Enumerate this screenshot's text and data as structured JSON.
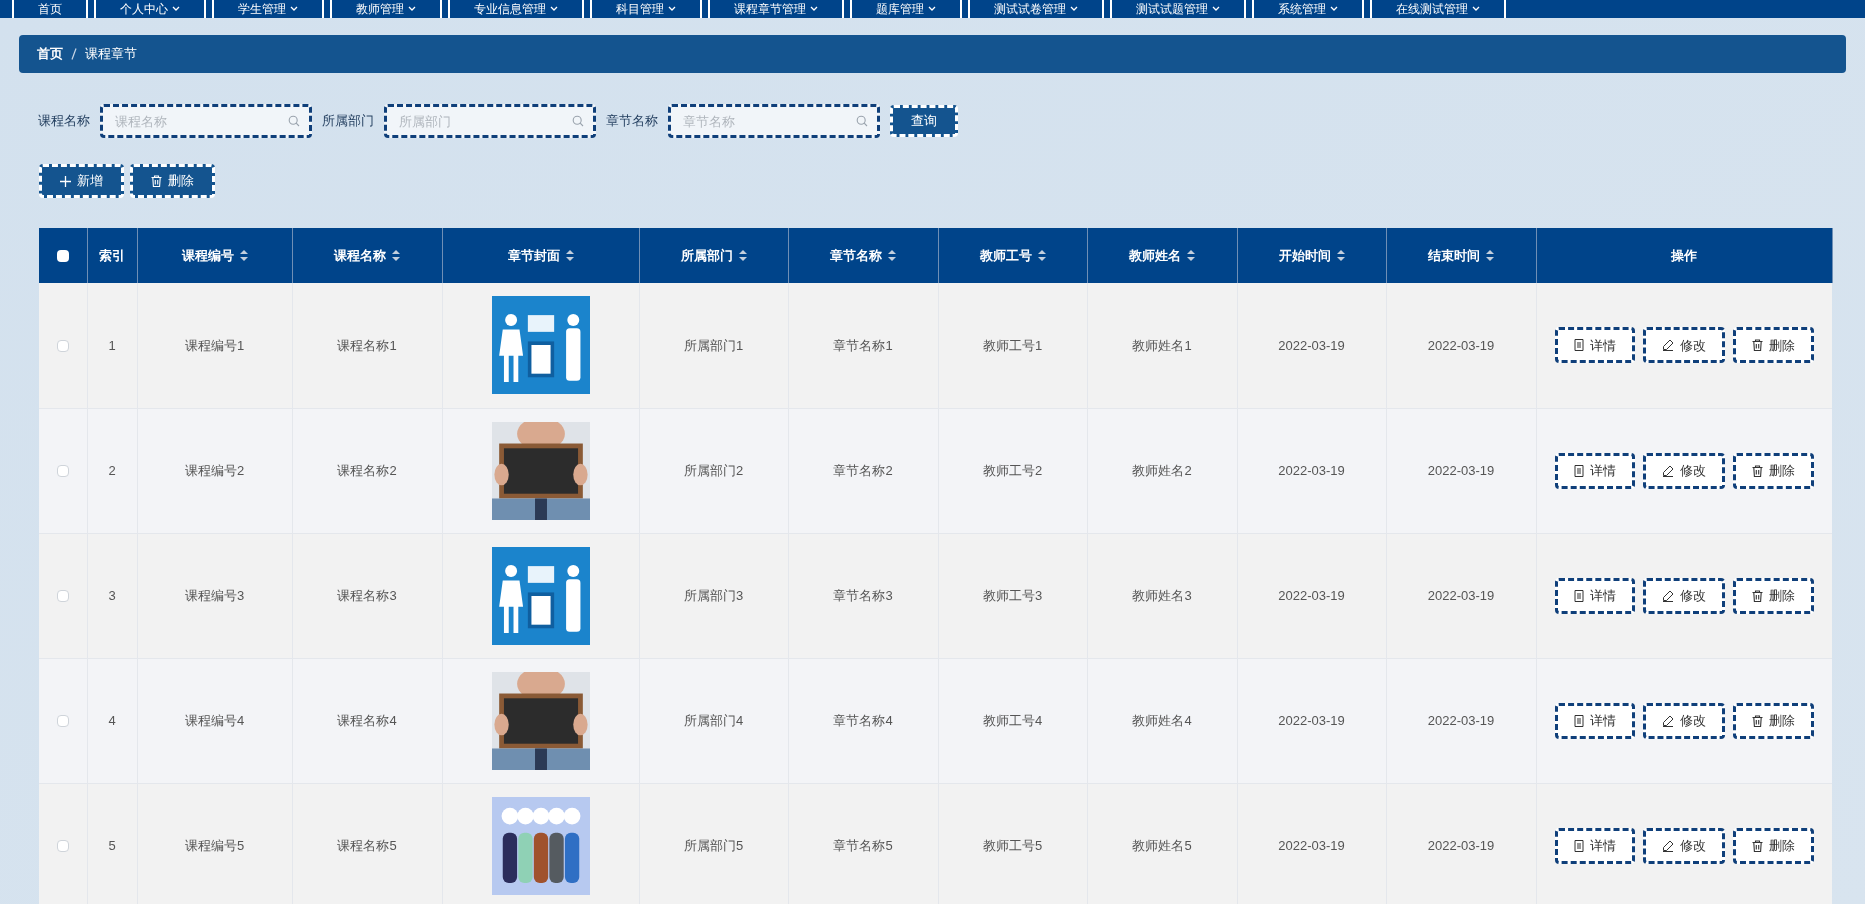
{
  "nav": [
    {
      "label": "首页",
      "dropdown": false
    },
    {
      "label": "个人中心",
      "dropdown": true
    },
    {
      "label": "学生管理",
      "dropdown": true
    },
    {
      "label": "教师管理",
      "dropdown": true
    },
    {
      "label": "专业信息管理",
      "dropdown": true
    },
    {
      "label": "科目管理",
      "dropdown": true
    },
    {
      "label": "课程章节管理",
      "dropdown": true
    },
    {
      "label": "题库管理",
      "dropdown": true
    },
    {
      "label": "测试试卷管理",
      "dropdown": true
    },
    {
      "label": "测试试题管理",
      "dropdown": true
    },
    {
      "label": "系统管理",
      "dropdown": true
    },
    {
      "label": "在线测试管理",
      "dropdown": true
    }
  ],
  "breadcrumb": [
    "首页",
    "课程章节"
  ],
  "search": {
    "fields": [
      {
        "label": "课程名称",
        "placeholder": "课程名称"
      },
      {
        "label": "所属部门",
        "placeholder": "所属部门"
      },
      {
        "label": "章节名称",
        "placeholder": "章节名称"
      }
    ],
    "button": "查询"
  },
  "actions": [
    {
      "kind": "add",
      "label": "新增"
    },
    {
      "kind": "delete",
      "label": "删除"
    }
  ],
  "table": {
    "select_all": {
      "checked": false
    },
    "columns": [
      {
        "label": "索引",
        "sortable": false
      },
      {
        "label": "课程编号",
        "sortable": true
      },
      {
        "label": "课程名称",
        "sortable": true
      },
      {
        "label": "章节封面",
        "sortable": true
      },
      {
        "label": "所属部门",
        "sortable": true
      },
      {
        "label": "章节名称",
        "sortable": true
      },
      {
        "label": "教师工号",
        "sortable": true
      },
      {
        "label": "教师姓名",
        "sortable": true
      },
      {
        "label": "开始时间",
        "sortable": true
      },
      {
        "label": "结束时间",
        "sortable": true
      },
      {
        "label": "操作",
        "sortable": false
      }
    ],
    "rows": [
      {
        "checked": false,
        "cells": [
          "1",
          "课程编号1",
          "课程名称1",
          null,
          "所属部门1",
          "章节名称1",
          "教师工号1",
          "教师姓名1",
          "2022-03-19",
          "2022-03-19"
        ],
        "actions": [
          {
            "kind": "detail",
            "label": "详情"
          },
          {
            "kind": "edit",
            "label": "修改"
          },
          {
            "kind": "delete",
            "label": "删除"
          }
        ]
      },
      {
        "checked": false,
        "cells": [
          "2",
          "课程编号2",
          "课程名称2",
          null,
          "所属部门2",
          "章节名称2",
          "教师工号2",
          "教师姓名2",
          "2022-03-19",
          "2022-03-19"
        ],
        "actions": [
          {
            "kind": "detail",
            "label": "详情"
          },
          {
            "kind": "edit",
            "label": "修改"
          },
          {
            "kind": "delete",
            "label": "删除"
          }
        ]
      },
      {
        "checked": false,
        "cells": [
          "3",
          "课程编号3",
          "课程名称3",
          null,
          "所属部门3",
          "章节名称3",
          "教师工号3",
          "教师姓名3",
          "2022-03-19",
          "2022-03-19"
        ],
        "actions": [
          {
            "kind": "detail",
            "label": "详情"
          },
          {
            "kind": "edit",
            "label": "修改"
          },
          {
            "kind": "delete",
            "label": "删除"
          }
        ]
      },
      {
        "checked": false,
        "cells": [
          "4",
          "课程编号4",
          "课程名称4",
          null,
          "所属部门4",
          "章节名称4",
          "教师工号4",
          "教师姓名4",
          "2022-03-19",
          "2022-03-19"
        ],
        "actions": [
          {
            "kind": "detail",
            "label": "详情"
          },
          {
            "kind": "edit",
            "label": "修改"
          },
          {
            "kind": "delete",
            "label": "删除"
          }
        ]
      },
      {
        "checked": false,
        "cells": [
          "5",
          "课程编号5",
          "课程名称5",
          null,
          "所属部门5",
          "章节名称5",
          "教师工号5",
          "教师姓名5",
          "2022-03-19",
          "2022-03-19"
        ],
        "actions": [
          {
            "kind": "detail",
            "label": "详情"
          },
          {
            "kind": "edit",
            "label": "修改"
          },
          {
            "kind": "delete",
            "label": "删除"
          }
        ]
      }
    ]
  }
}
